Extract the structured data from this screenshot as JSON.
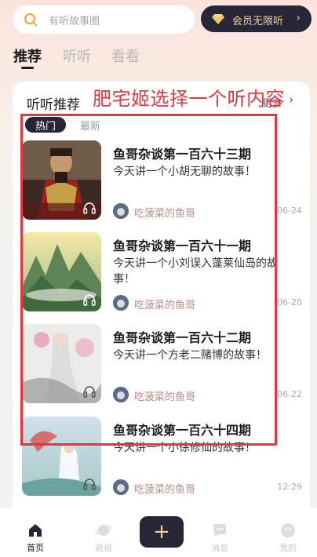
{
  "search": {
    "placeholder": "有听故事圈"
  },
  "vip": {
    "label": "会员无限听",
    "arrow": "›"
  },
  "tabs": [
    {
      "label": "推荐",
      "active": true
    },
    {
      "label": "听听",
      "active": false
    },
    {
      "label": "看看",
      "active": false
    }
  ],
  "card": {
    "title": "听听推荐",
    "more_label": "更多",
    "more_chevron": "›",
    "sub_tabs": [
      "热门",
      "最新"
    ]
  },
  "annotation": {
    "text": "肥宅姬选择一个听内容",
    "color": "#e8353d"
  },
  "items": [
    {
      "title": "鱼哥杂谈第一百六十三期",
      "desc": "今天讲一个小胡无聊的故事！",
      "author": "吃菠菜的鱼哥",
      "date": "06-24",
      "cover": "warrior"
    },
    {
      "title": "鱼哥杂谈第一百六十一期",
      "desc": "今天讲一个小刘误入蓬莱仙岛的故事！",
      "author": "吃菠菜的鱼哥",
      "date": "06-20",
      "cover": "mountain"
    },
    {
      "title": "鱼哥杂谈第一百六十二期",
      "desc": "今天讲一个方老二赌博的故事！",
      "author": "吃菠菜的鱼哥",
      "date": "06-22",
      "cover": "lady"
    },
    {
      "title": "鱼哥杂谈第一百六十四期",
      "desc": "今天讲一个小徐修仙的故事！",
      "author": "吃菠菜的鱼哥",
      "date": "12:29",
      "cover": "fairy"
    }
  ],
  "bottom_nav": {
    "home": "首页",
    "talk": "说说",
    "plus": "+",
    "message": "消息",
    "mine": "我的"
  }
}
